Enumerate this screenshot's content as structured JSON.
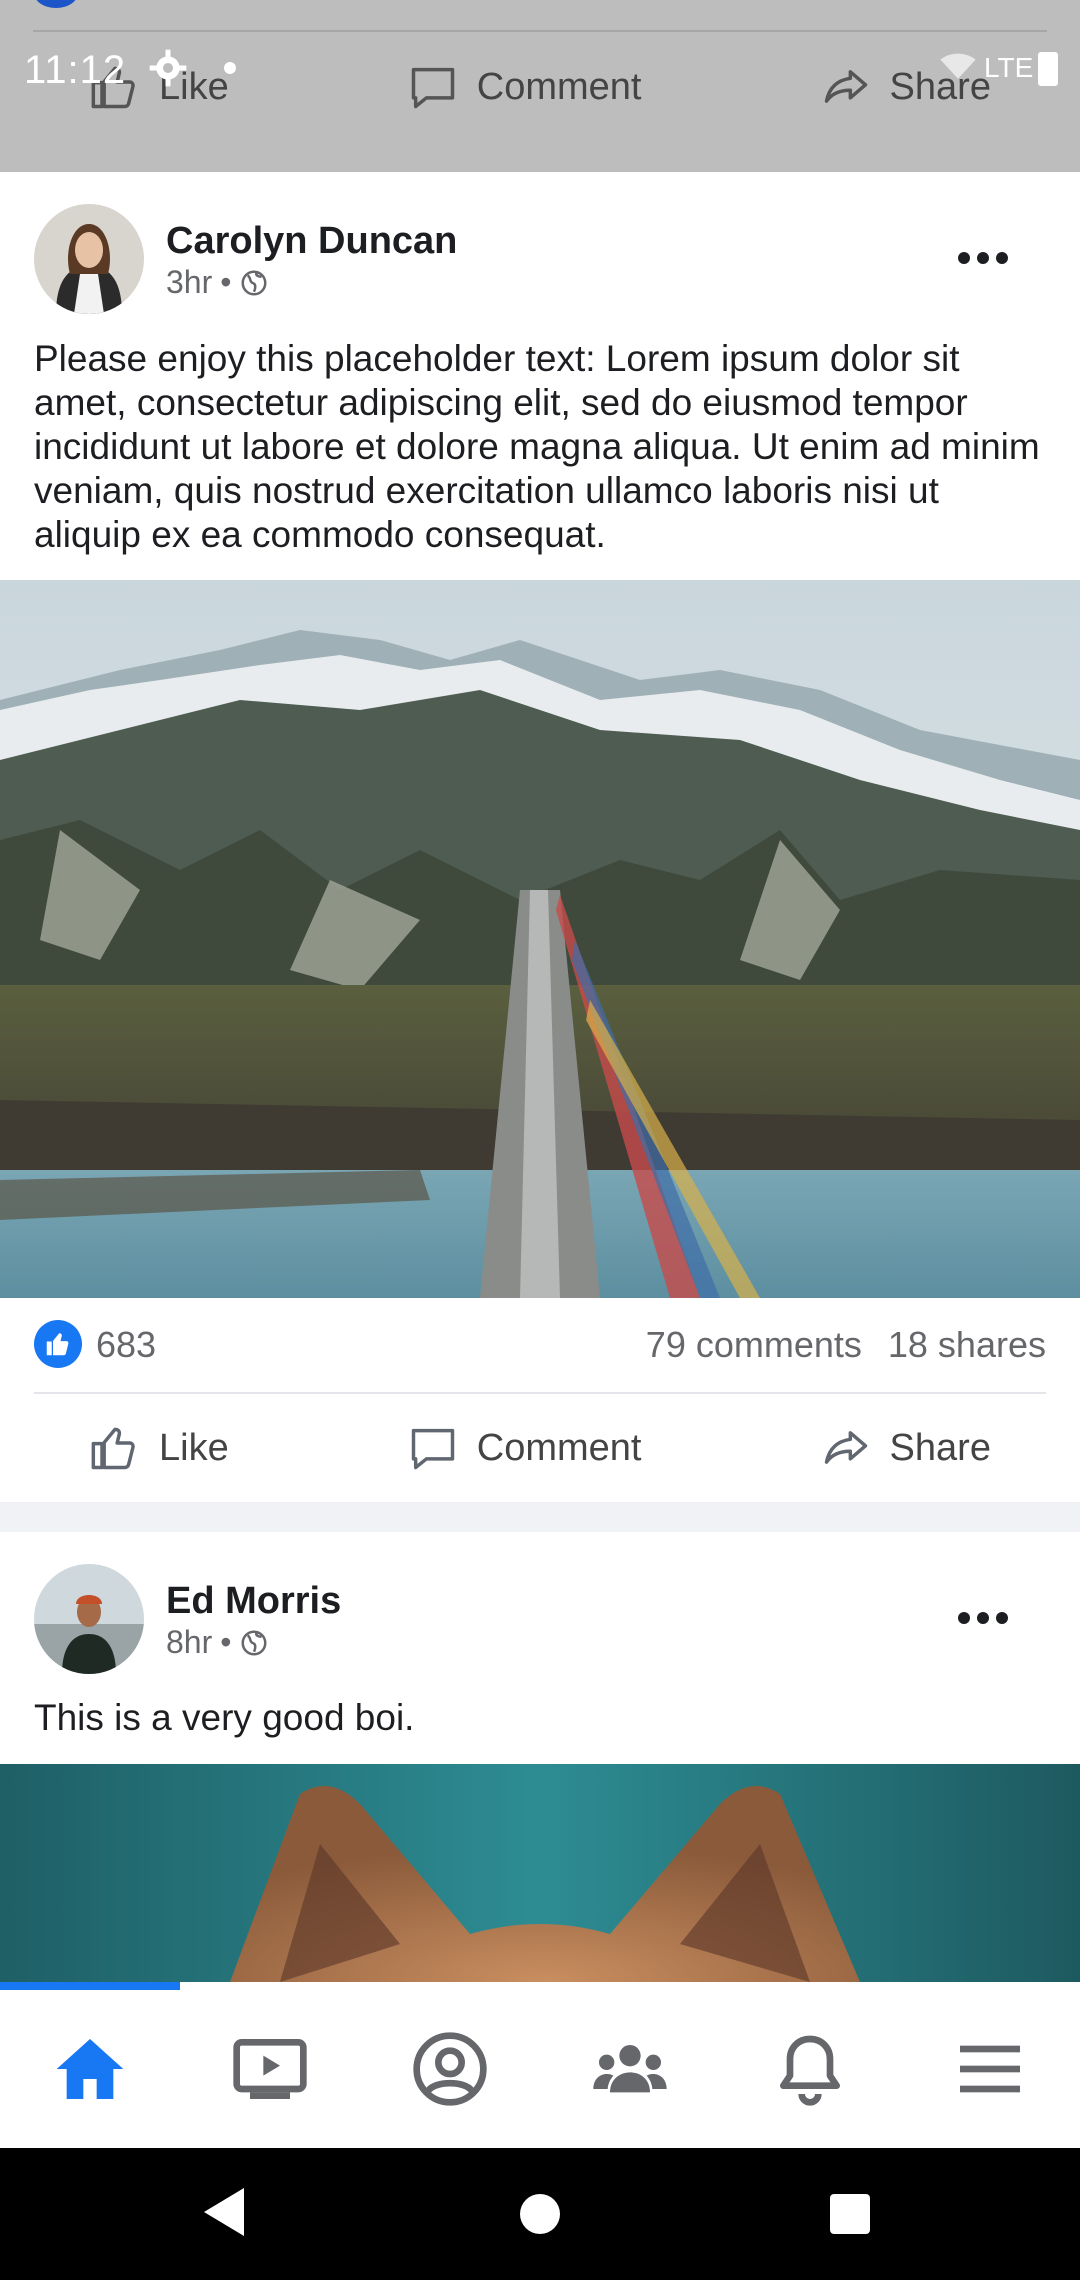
{
  "status_bar": {
    "time": "11:12",
    "network": "LTE"
  },
  "post_actions": {
    "like": "Like",
    "comment": "Comment",
    "share": "Share"
  },
  "posts": [
    {
      "author": "Carolyn Duncan",
      "time": "3hr",
      "separator": "•",
      "text": "Please enjoy this placeholder text: Lorem ipsum dolor sit amet, consectetur adipiscing elit, sed do eiusmod tempor incididunt ut labore et dolore magna aliqua. Ut enim ad minim veniam, quis nostrud exercitation ullamco laboris nisi ut aliquip ex ea commodo consequat.",
      "likes": "683",
      "comments": "79 comments",
      "shares": "18 shares"
    },
    {
      "author": "Ed Morris",
      "time": "8hr",
      "separator": "•",
      "text": "This is a very good boi."
    }
  ],
  "bottom_nav": {
    "active": "home",
    "items": [
      "home-icon",
      "video-icon",
      "profile-icon",
      "groups-icon",
      "notifications-icon",
      "menu-icon"
    ]
  },
  "colors": {
    "accent": "#1877f2",
    "text": "#1c1e21",
    "muted": "#65676b"
  }
}
